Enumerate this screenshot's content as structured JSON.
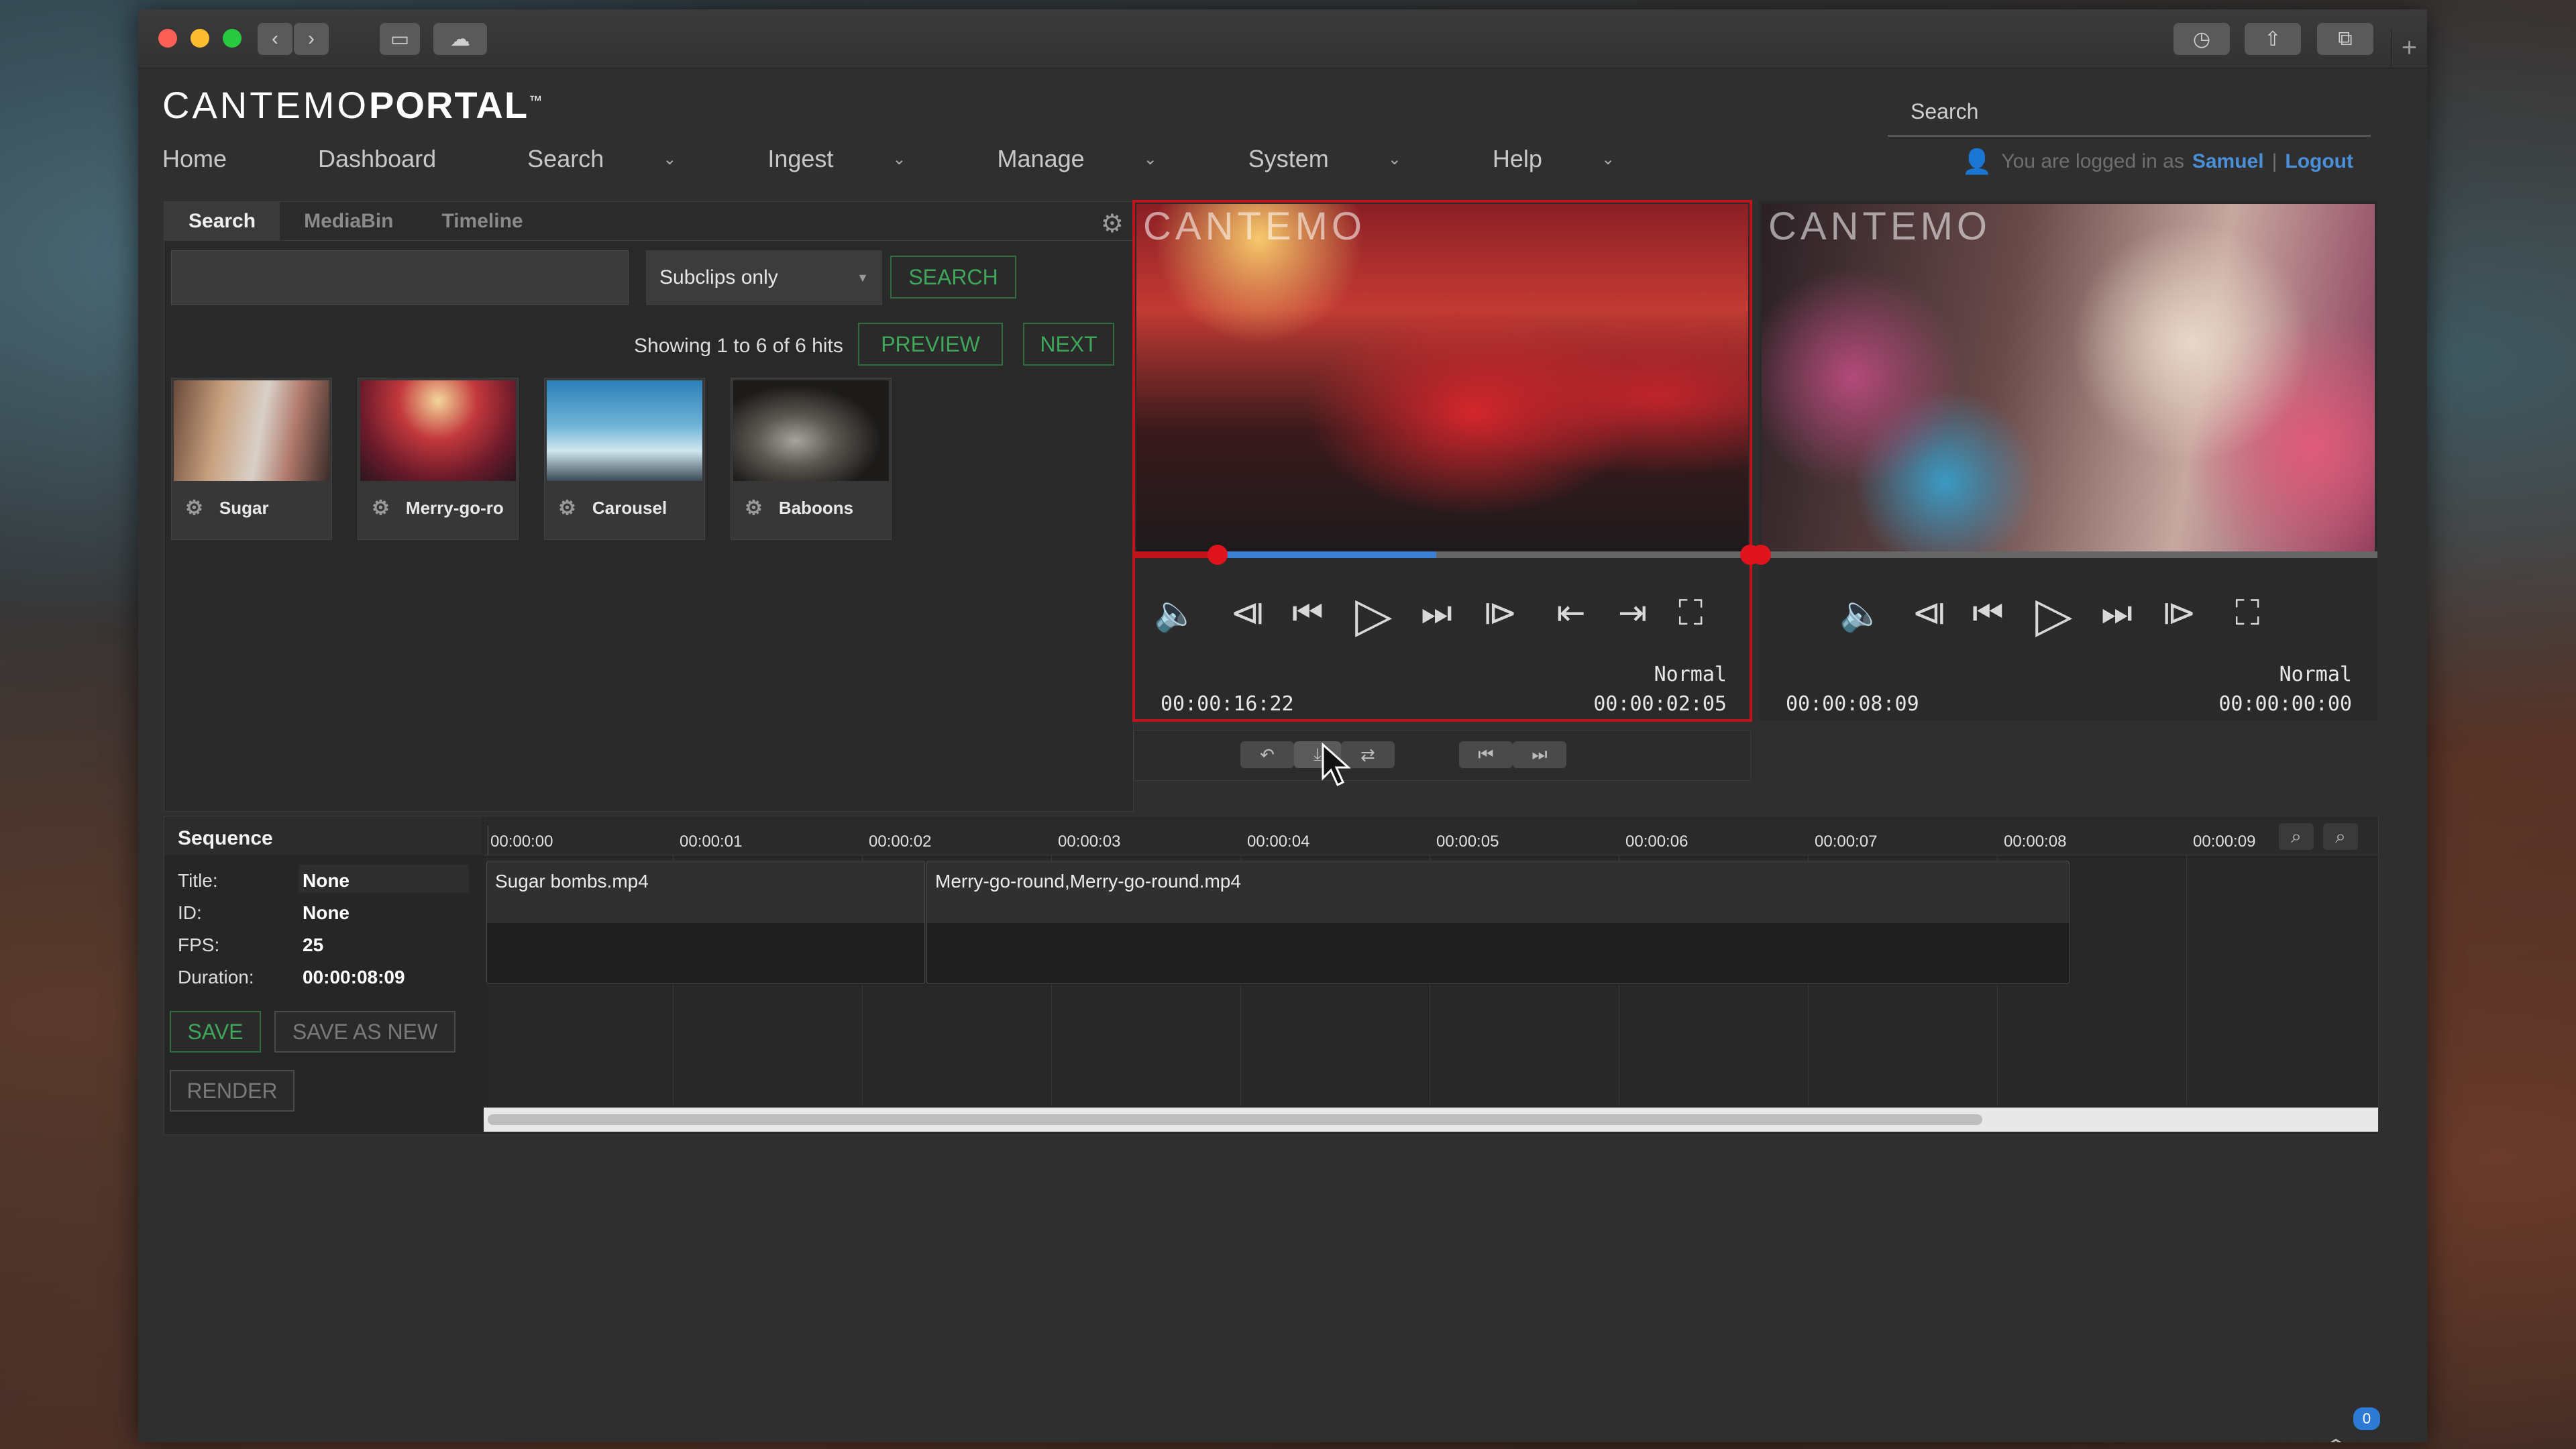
{
  "logo": {
    "light": "CANTEMO",
    "bold": "PORTAL",
    "tm": "™"
  },
  "top_search": {
    "placeholder": "Search"
  },
  "nav": [
    {
      "label": "Home",
      "has_menu": false
    },
    {
      "label": "Dashboard",
      "has_menu": false
    },
    {
      "label": "Search",
      "has_menu": true
    },
    {
      "label": "Ingest",
      "has_menu": true
    },
    {
      "label": "Manage",
      "has_menu": true
    },
    {
      "label": "System",
      "has_menu": true
    },
    {
      "label": "Help",
      "has_menu": true
    }
  ],
  "login": {
    "prefix": "You are logged in as",
    "user": "Samuel",
    "separator": "|",
    "logout": "Logout"
  },
  "search_panel": {
    "tabs": [
      "Search",
      "MediaBin",
      "Timeline"
    ],
    "active_tab": "Search",
    "query": "",
    "filter": "Subclips only",
    "search_button": "SEARCH",
    "hits_text": "Showing 1 to 6 of 6 hits",
    "prev_button": "PREVIEW",
    "next_button": "NEXT",
    "results": [
      "Sugar",
      "Merry-go-ro",
      "Carousel",
      "Baboons"
    ]
  },
  "players": [
    {
      "watermark": "CANTEMO",
      "mode": "Normal",
      "current": "00:00:16:22",
      "duration": "00:00:02:05",
      "progress": 0.49
    },
    {
      "watermark": "CANTEMO",
      "mode": "Normal",
      "current": "00:00:08:09",
      "duration": "00:00:00:00",
      "progress": 0.0
    }
  ],
  "sequence": {
    "heading": "Sequence",
    "fields": [
      {
        "label": "Title:",
        "value": "None"
      },
      {
        "label": "ID:",
        "value": "None"
      },
      {
        "label": "FPS:",
        "value": "25"
      },
      {
        "label": "Duration:",
        "value": "00:00:08:09"
      }
    ],
    "save": "SAVE",
    "save_as_new": "SAVE AS NEW",
    "render": "RENDER",
    "ruler": [
      "00:00:00",
      "00:00:01",
      "00:00:02",
      "00:00:03",
      "00:00:04",
      "00:00:05",
      "00:00:06",
      "00:00:07",
      "00:00:08",
      "00:00:09"
    ],
    "clips": [
      "Sugar bombs.mp4",
      "Merry-go-round,Merry-go-round.mp4"
    ]
  },
  "notifications": {
    "count": "0"
  },
  "colors": {
    "accent_green": "#3fa65a",
    "link_blue": "#4a90d9",
    "active_red": "#c0141c"
  }
}
